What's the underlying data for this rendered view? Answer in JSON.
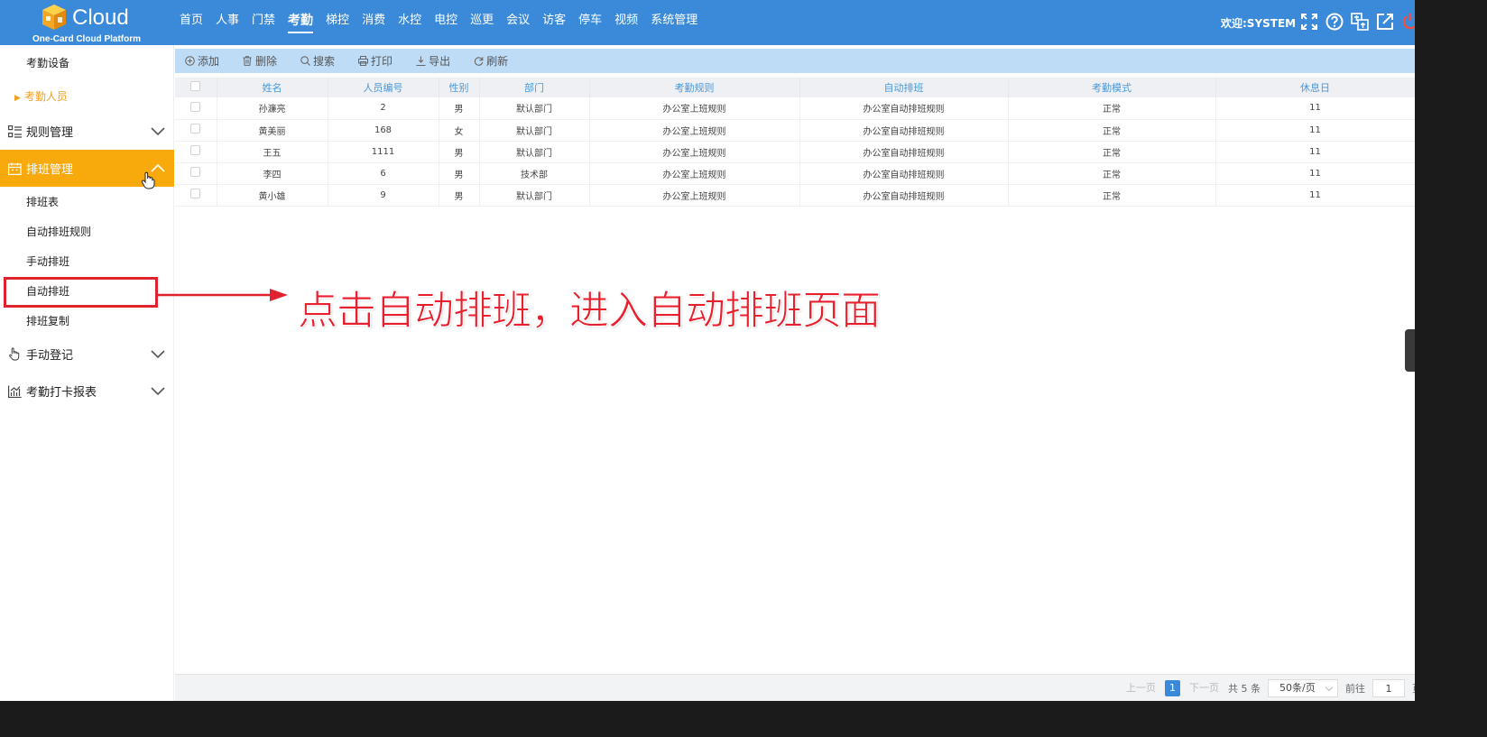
{
  "brand": {
    "title": "Cloud",
    "subtitle": "One-Card Cloud Platform"
  },
  "nav": {
    "items": [
      "首页",
      "人事",
      "门禁",
      "考勤",
      "梯控",
      "消费",
      "水控",
      "电控",
      "巡更",
      "会议",
      "访客",
      "停车",
      "视频",
      "系统管理"
    ],
    "active": "考勤"
  },
  "header": {
    "welcome": "欢迎:SYSTEM"
  },
  "sidebar": {
    "top_item": "考勤设备",
    "attendance_people": "考勤人员",
    "rules_group": "规则管理",
    "schedule_group": "排班管理",
    "schedule_items": [
      "排班表",
      "自动排班规则",
      "手动排班",
      "自动排班",
      "排班复制"
    ],
    "manual_group": "手动登记",
    "report_group": "考勤打卡报表"
  },
  "toolbar": {
    "add": "添加",
    "delete": "删除",
    "search": "搜索",
    "print": "打印",
    "export": "导出",
    "refresh": "刷新"
  },
  "table": {
    "columns": [
      "姓名",
      "人员编号",
      "性别",
      "部门",
      "考勤规则",
      "自动排班",
      "考勤模式",
      "休息日"
    ],
    "rows": [
      [
        "孙濂亮",
        "2",
        "男",
        "默认部门",
        "办公室上班规则",
        "办公室自动排班规则",
        "正常",
        "11"
      ],
      [
        "黄美丽",
        "168",
        "女",
        "默认部门",
        "办公室上班规则",
        "办公室自动排班规则",
        "正常",
        "11"
      ],
      [
        "王五",
        "1111",
        "男",
        "默认部门",
        "办公室上班规则",
        "办公室自动排班规则",
        "正常",
        "11"
      ],
      [
        "李四",
        "6",
        "男",
        "技术部",
        "办公室上班规则",
        "办公室自动排班规则",
        "正常",
        "11"
      ],
      [
        "黄小雄",
        "9",
        "男",
        "默认部门",
        "办公室上班规则",
        "办公室自动排班规则",
        "正常",
        "11"
      ]
    ]
  },
  "annotation": {
    "text": "点击自动排班，进入自动排班页面"
  },
  "pagination": {
    "prev": "上一页",
    "current": "1",
    "next": "下一页",
    "total": "共 5 条",
    "page_size": "50条/页",
    "goto": "前往",
    "goto_value": "1",
    "page_unit": "页"
  },
  "colors": {
    "header": "#3b8ad9",
    "active_menu": "#f8a90c",
    "annotation": "#e8202e",
    "toolbar": "#bfdcf6"
  }
}
